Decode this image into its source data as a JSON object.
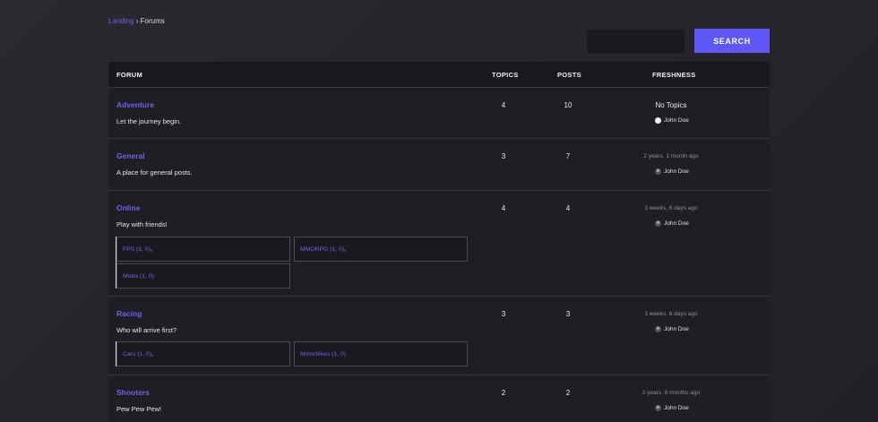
{
  "breadcrumb": {
    "home": "Landing",
    "separator": "›",
    "current": "Forums"
  },
  "search": {
    "placeholder": "",
    "button_label": "SEARCH"
  },
  "table": {
    "headers": {
      "forum": "FORUM",
      "topics": "TOPICS",
      "posts": "POSTS",
      "freshness": "FRESHNESS"
    },
    "rows": [
      {
        "title": "Adventure",
        "description": "Let the journey begin.",
        "topics": "4",
        "posts": "10",
        "freshness": "No Topics",
        "user": "John Doe",
        "subforums": []
      },
      {
        "title": "General",
        "description": "A place for general posts.",
        "topics": "3",
        "posts": "7",
        "freshness": "2 years, 1 month ago",
        "user": "John Doe",
        "subforums": []
      },
      {
        "title": "Online",
        "description": "Play with friends!",
        "topics": "4",
        "posts": "4",
        "freshness": "3 weeks, 6 days ago",
        "user": "John Doe",
        "subforums": [
          {
            "label": "FPS (1, 0)",
            "sep": ","
          },
          {
            "label": "MMORPG (1, 0)",
            "sep": ","
          },
          {
            "label": "Moba (1, 0)",
            "sep": ""
          }
        ]
      },
      {
        "title": "Racing",
        "description": "Who will arrive first?",
        "topics": "3",
        "posts": "3",
        "freshness": "3 weeks, 6 days ago",
        "user": "John Doe",
        "subforums": [
          {
            "label": "Cars (1, 0)",
            "sep": ","
          },
          {
            "label": "Motorbikes (1, 0)",
            "sep": ""
          }
        ]
      },
      {
        "title": "Shooters",
        "description": "Pew Pew Pew!",
        "topics": "2",
        "posts": "2",
        "freshness": "2 years, 6 months ago",
        "user": "John Doe",
        "subforums": []
      }
    ]
  },
  "colors": {
    "accent": "#5f57f5",
    "link": "#6b62f0",
    "background": "#26252b"
  }
}
